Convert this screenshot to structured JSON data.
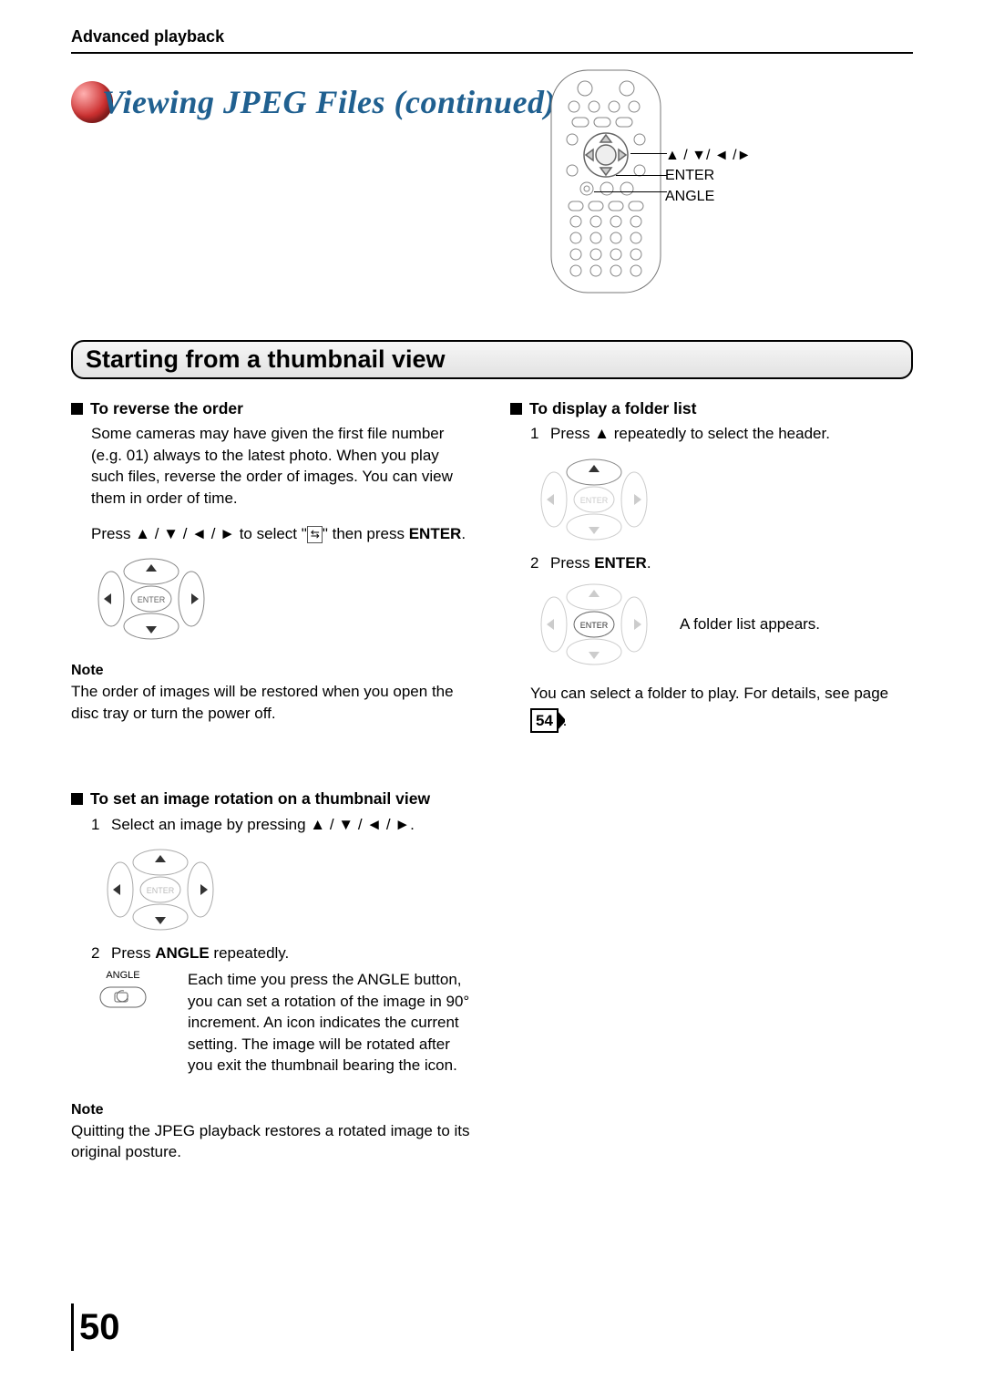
{
  "header": "Advanced playback",
  "title": "Viewing JPEG Files (continued)",
  "remote_labels": {
    "arrows": "▲ / ▼/ ◄ /►",
    "enter": "ENTER",
    "angle": "ANGLE"
  },
  "section_bar": "Starting from a thumbnail view",
  "left": {
    "reverse": {
      "heading": "To reverse the order",
      "p1": "Some cameras may have given the first file number (e.g. 01) always to the latest photo. When you play such files, reverse the order of images. You can view them in order of time.",
      "p2_a": "Press ▲ / ▼ / ◄ / ► to select \"",
      "p2_icon_label": "↔",
      "p2_b": "\" then press ",
      "p2_bold": "ENTER",
      "p2_c": "."
    },
    "note1_label": "Note",
    "note1_text": "The order of images will be restored when you open the disc tray or turn the power off.",
    "rotation": {
      "heading": "To set an image rotation on a thumbnail view",
      "step1_num": "1",
      "step1": "Select an image by pressing ▲ / ▼ / ◄ / ►.",
      "step2_num": "2",
      "step2_a": "Press ",
      "step2_bold": "ANGLE",
      "step2_b": " repeatedly.",
      "angle_label": "ANGLE",
      "angle_desc": "Each time you press the ANGLE button, you can set a rotation of the image in 90° increment. An icon indicates the current setting. The image will be rotated after you exit the thumbnail bearing the icon."
    },
    "note2_label": "Note",
    "note2_text": "Quitting the JPEG playback restores a rotated image to its original posture."
  },
  "right": {
    "folder": {
      "heading": "To display a folder list",
      "step1_num": "1",
      "step1": "Press ▲ repeatedly to select the header.",
      "step2_num": "2",
      "step2_a": "Press ",
      "step2_bold": "ENTER",
      "step2_b": ".",
      "after2": "A folder list appears.",
      "final_a": "You can select a folder to play.  For details, see page ",
      "page_ref": "54",
      "final_b": "."
    }
  },
  "page_number": "50"
}
